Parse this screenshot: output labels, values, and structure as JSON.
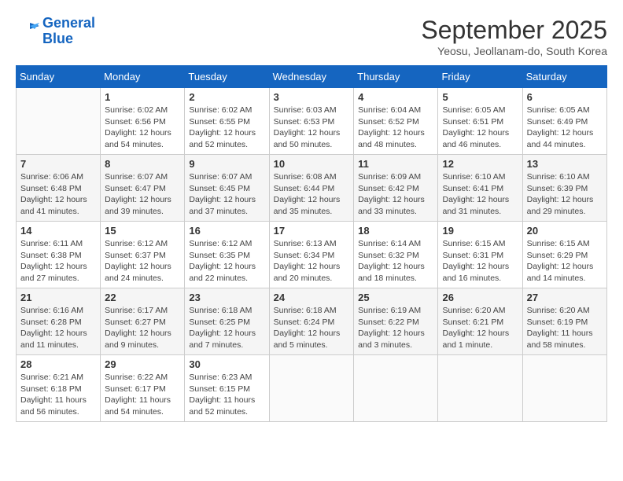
{
  "header": {
    "logo_line1": "General",
    "logo_line2": "Blue",
    "month_title": "September 2025",
    "subtitle": "Yeosu, Jeollanam-do, South Korea"
  },
  "weekdays": [
    "Sunday",
    "Monday",
    "Tuesday",
    "Wednesday",
    "Thursday",
    "Friday",
    "Saturday"
  ],
  "weeks": [
    [
      {
        "day": null
      },
      {
        "day": "1",
        "sunrise": "6:02 AM",
        "sunset": "6:56 PM",
        "daylight": "12 hours and 54 minutes."
      },
      {
        "day": "2",
        "sunrise": "6:02 AM",
        "sunset": "6:55 PM",
        "daylight": "12 hours and 52 minutes."
      },
      {
        "day": "3",
        "sunrise": "6:03 AM",
        "sunset": "6:53 PM",
        "daylight": "12 hours and 50 minutes."
      },
      {
        "day": "4",
        "sunrise": "6:04 AM",
        "sunset": "6:52 PM",
        "daylight": "12 hours and 48 minutes."
      },
      {
        "day": "5",
        "sunrise": "6:05 AM",
        "sunset": "6:51 PM",
        "daylight": "12 hours and 46 minutes."
      },
      {
        "day": "6",
        "sunrise": "6:05 AM",
        "sunset": "6:49 PM",
        "daylight": "12 hours and 44 minutes."
      }
    ],
    [
      {
        "day": "7",
        "sunrise": "6:06 AM",
        "sunset": "6:48 PM",
        "daylight": "12 hours and 41 minutes."
      },
      {
        "day": "8",
        "sunrise": "6:07 AM",
        "sunset": "6:47 PM",
        "daylight": "12 hours and 39 minutes."
      },
      {
        "day": "9",
        "sunrise": "6:07 AM",
        "sunset": "6:45 PM",
        "daylight": "12 hours and 37 minutes."
      },
      {
        "day": "10",
        "sunrise": "6:08 AM",
        "sunset": "6:44 PM",
        "daylight": "12 hours and 35 minutes."
      },
      {
        "day": "11",
        "sunrise": "6:09 AM",
        "sunset": "6:42 PM",
        "daylight": "12 hours and 33 minutes."
      },
      {
        "day": "12",
        "sunrise": "6:10 AM",
        "sunset": "6:41 PM",
        "daylight": "12 hours and 31 minutes."
      },
      {
        "day": "13",
        "sunrise": "6:10 AM",
        "sunset": "6:39 PM",
        "daylight": "12 hours and 29 minutes."
      }
    ],
    [
      {
        "day": "14",
        "sunrise": "6:11 AM",
        "sunset": "6:38 PM",
        "daylight": "12 hours and 27 minutes."
      },
      {
        "day": "15",
        "sunrise": "6:12 AM",
        "sunset": "6:37 PM",
        "daylight": "12 hours and 24 minutes."
      },
      {
        "day": "16",
        "sunrise": "6:12 AM",
        "sunset": "6:35 PM",
        "daylight": "12 hours and 22 minutes."
      },
      {
        "day": "17",
        "sunrise": "6:13 AM",
        "sunset": "6:34 PM",
        "daylight": "12 hours and 20 minutes."
      },
      {
        "day": "18",
        "sunrise": "6:14 AM",
        "sunset": "6:32 PM",
        "daylight": "12 hours and 18 minutes."
      },
      {
        "day": "19",
        "sunrise": "6:15 AM",
        "sunset": "6:31 PM",
        "daylight": "12 hours and 16 minutes."
      },
      {
        "day": "20",
        "sunrise": "6:15 AM",
        "sunset": "6:29 PM",
        "daylight": "12 hours and 14 minutes."
      }
    ],
    [
      {
        "day": "21",
        "sunrise": "6:16 AM",
        "sunset": "6:28 PM",
        "daylight": "12 hours and 11 minutes."
      },
      {
        "day": "22",
        "sunrise": "6:17 AM",
        "sunset": "6:27 PM",
        "daylight": "12 hours and 9 minutes."
      },
      {
        "day": "23",
        "sunrise": "6:18 AM",
        "sunset": "6:25 PM",
        "daylight": "12 hours and 7 minutes."
      },
      {
        "day": "24",
        "sunrise": "6:18 AM",
        "sunset": "6:24 PM",
        "daylight": "12 hours and 5 minutes."
      },
      {
        "day": "25",
        "sunrise": "6:19 AM",
        "sunset": "6:22 PM",
        "daylight": "12 hours and 3 minutes."
      },
      {
        "day": "26",
        "sunrise": "6:20 AM",
        "sunset": "6:21 PM",
        "daylight": "12 hours and 1 minute."
      },
      {
        "day": "27",
        "sunrise": "6:20 AM",
        "sunset": "6:19 PM",
        "daylight": "11 hours and 58 minutes."
      }
    ],
    [
      {
        "day": "28",
        "sunrise": "6:21 AM",
        "sunset": "6:18 PM",
        "daylight": "11 hours and 56 minutes."
      },
      {
        "day": "29",
        "sunrise": "6:22 AM",
        "sunset": "6:17 PM",
        "daylight": "11 hours and 54 minutes."
      },
      {
        "day": "30",
        "sunrise": "6:23 AM",
        "sunset": "6:15 PM",
        "daylight": "11 hours and 52 minutes."
      },
      {
        "day": null
      },
      {
        "day": null
      },
      {
        "day": null
      },
      {
        "day": null
      }
    ]
  ],
  "labels": {
    "sunrise_prefix": "Sunrise: ",
    "sunset_prefix": "Sunset: ",
    "daylight_prefix": "Daylight: "
  }
}
